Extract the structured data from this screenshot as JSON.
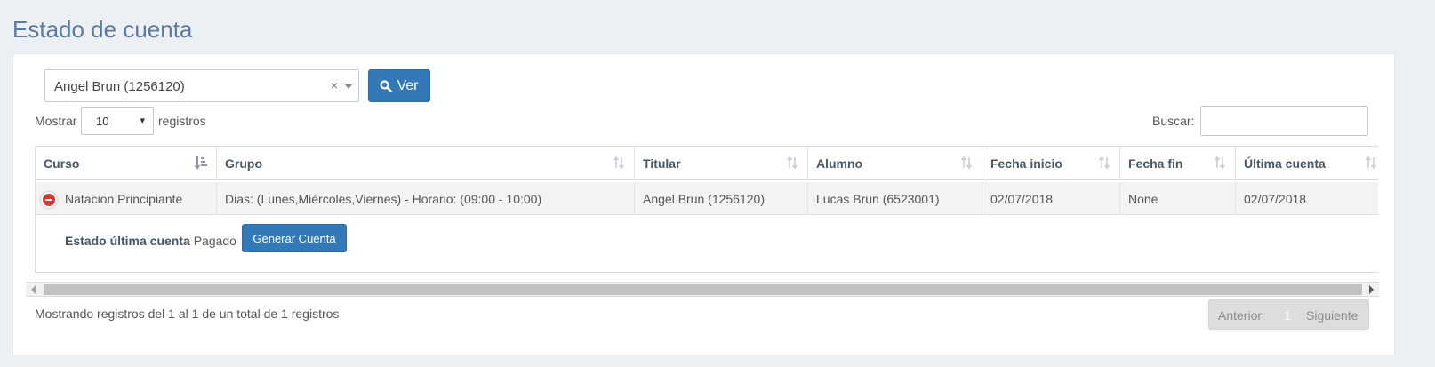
{
  "page": {
    "title": "Estado de cuenta"
  },
  "filter": {
    "selected": "Angel Brun (1256120)",
    "clear_symbol": "×",
    "button_label": "Ver"
  },
  "length": {
    "prefix": "Mostrar",
    "value": "10",
    "arrow": "▾",
    "suffix": "registros"
  },
  "search": {
    "label": "Buscar:",
    "value": ""
  },
  "table": {
    "columns": [
      "Curso",
      "Grupo",
      "Titular",
      "Alumno",
      "Fecha inicio",
      "Fecha fin",
      "Última cuenta"
    ],
    "rows": [
      {
        "curso": "Natacion Principiante",
        "grupo": "Dias: (Lunes,Miércoles,Viernes) - Horario: (09:00 - 10:00)",
        "titular": "Angel Brun (1256120)",
        "alumno": "Lucas Brun (6523001)",
        "fecha_inicio": "02/07/2018",
        "fecha_fin": "None",
        "ultima_cuenta": "02/07/2018"
      }
    ],
    "child": {
      "label": "Estado última cuenta",
      "value": "Pagado",
      "button_label": "Generar Cuenta"
    }
  },
  "footer": {
    "info": "Mostrando registros del 1 al 1 de un total de 1 registros",
    "prev": "Anterior",
    "page": "1",
    "next": "Siguiente"
  },
  "colors": {
    "primary": "#3479b7",
    "title": "#5b7b9d",
    "danger": "#d33a30"
  }
}
